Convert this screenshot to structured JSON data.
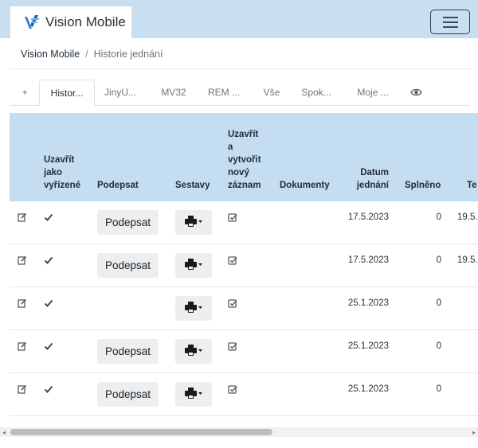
{
  "navbar": {
    "brand_text": "Vision Mobile",
    "menu_icon": "hamburger-icon",
    "logo_color": "#2f7fd6"
  },
  "breadcrumb": {
    "home": "Vision Mobile",
    "separator": "/",
    "current": "Historie jednání"
  },
  "tabs": [
    {
      "label": "+"
    },
    {
      "label": "Histor..."
    },
    {
      "label": "JinyU..."
    },
    {
      "label": "MV32"
    },
    {
      "label": "REM ..."
    },
    {
      "label": "Vše"
    },
    {
      "label": "Spok..."
    },
    {
      "label": "Moje ..."
    }
  ],
  "active_tab": 1,
  "table": {
    "headers": {
      "close": [
        "Uzavřít",
        "jako",
        "vyřízené"
      ],
      "sign": "Podepsat",
      "reports": "Sestavy",
      "close_create": [
        "Uzavřít",
        "a",
        "vytvořit",
        "nový",
        "záznam"
      ],
      "documents": "Dokumenty",
      "date": [
        "Datum",
        "jednání"
      ],
      "done": "Splněno",
      "term": "Te"
    },
    "sign_label": "Podepsat",
    "rows": [
      {
        "date": "17.5.2023",
        "done": "0",
        "term": "19.5..."
      },
      {
        "date": "17.5.2023",
        "done": "0",
        "term": "19.5..."
      },
      {
        "date": "25.1.2023",
        "done": "0",
        "term": ""
      },
      {
        "date": "25.1.2023",
        "done": "0",
        "term": ""
      },
      {
        "date": "25.1.2023",
        "done": "0",
        "term": ""
      }
    ]
  },
  "colors": {
    "header_bg": "#c5ddf0",
    "navbar_bg": "#c7dff1",
    "button_bg": "#eceeef"
  }
}
